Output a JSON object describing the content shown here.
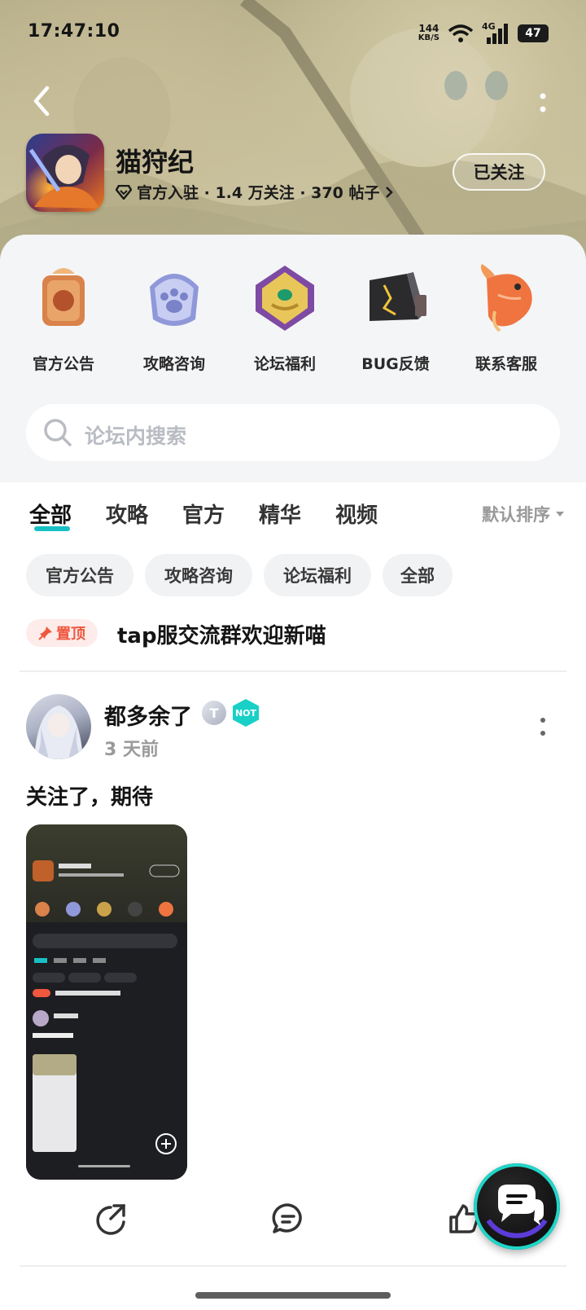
{
  "status_bar": {
    "time": "17:47:10",
    "net_speed_value": "144",
    "net_speed_unit": "KB/S",
    "network": "4G",
    "battery": "47"
  },
  "game": {
    "title": "猫狩纪",
    "meta": "官方入驻 · 1.4 万关注 · 370 帖子",
    "follow_label": "已关注"
  },
  "quick_links": [
    {
      "label": "官方公告",
      "icon": "announcement-seal-icon"
    },
    {
      "label": "攻略咨询",
      "icon": "paw-badge-icon"
    },
    {
      "label": "论坛福利",
      "icon": "jade-medal-icon"
    },
    {
      "label": "BUG反馈",
      "icon": "cracked-crystal-icon"
    },
    {
      "label": "联系客服",
      "icon": "koi-fish-icon"
    }
  ],
  "search": {
    "placeholder": "论坛内搜索"
  },
  "tabs": [
    {
      "label": "全部",
      "active": true
    },
    {
      "label": "攻略",
      "active": false
    },
    {
      "label": "官方",
      "active": false
    },
    {
      "label": "精华",
      "active": false
    },
    {
      "label": "视频",
      "active": false
    }
  ],
  "sort_label": "默认排序",
  "chips": [
    "官方公告",
    "攻略咨询",
    "论坛福利",
    "全部"
  ],
  "pinned": {
    "badge": "置顶",
    "title": "tap服交流群欢迎新喵"
  },
  "post": {
    "author": "都多余了",
    "level_badge": "T",
    "time": "3 天前",
    "text": "关注了，期待"
  },
  "colors": {
    "accent": "#18c0c4",
    "pin": "#f0573f",
    "pin_bg": "#fdecea",
    "panel_bg": "#f4f5f7"
  }
}
